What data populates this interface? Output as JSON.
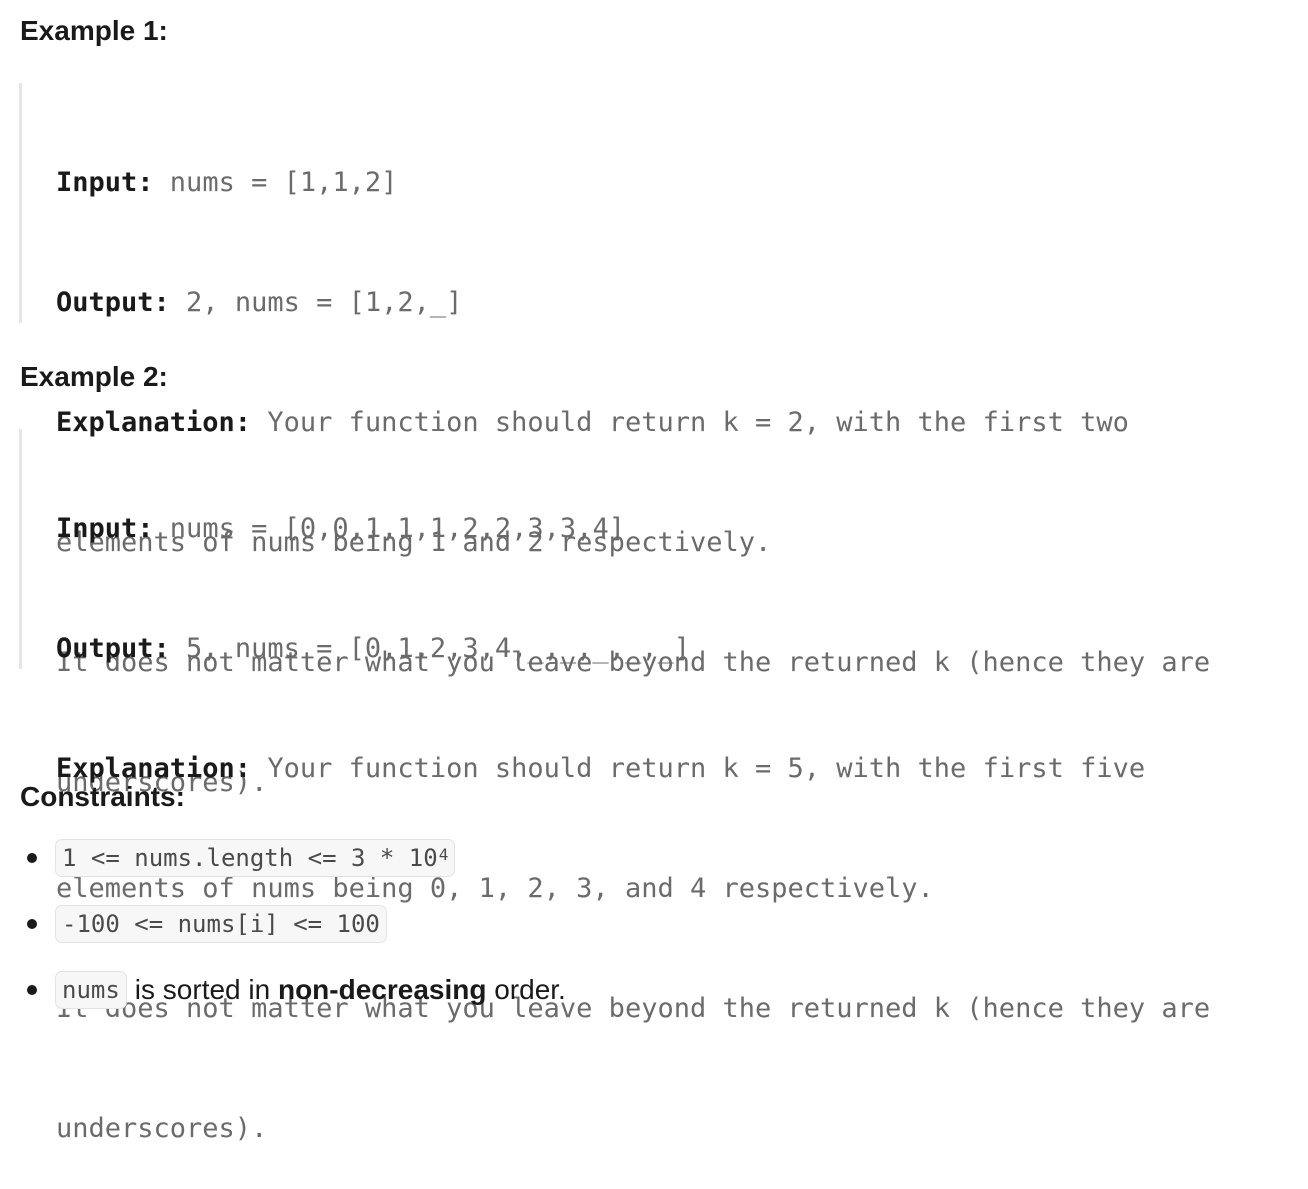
{
  "example1": {
    "heading": "Example 1:",
    "input_label": "Input:",
    "input_value": " nums = [1,1,2]",
    "output_label": "Output:",
    "output_value": " 2, nums = [1,2,_]",
    "explanation_label": "Explanation:",
    "explanation_line1": " Your function should return k = 2, with the first two",
    "explanation_line2": "elements of nums being 1 and 2 respectively.",
    "explanation_line3": "It does not matter what you leave beyond the returned k (hence they are",
    "explanation_line4": "underscores)."
  },
  "example2": {
    "heading": "Example 2:",
    "input_label": "Input:",
    "input_value": " nums = [0,0,1,1,1,2,2,3,3,4]",
    "output_label": "Output:",
    "output_value": " 5, nums = [0,1,2,3,4,_,_,_,_,_]",
    "explanation_label": "Explanation:",
    "explanation_line1": " Your function should return k = 5, with the first five",
    "explanation_line2": "elements of nums being 0, 1, 2, 3, and 4 respectively.",
    "explanation_line3": "It does not matter what you leave beyond the returned k (hence they are",
    "explanation_line4": "underscores)."
  },
  "constraints": {
    "heading": "Constraints:",
    "items": [
      {
        "code": "1 <= nums.length <= 3 * 10",
        "sup": "4"
      },
      {
        "code": "-100 <= nums[i] <= 100"
      },
      {
        "code": "nums",
        "text_before_bold": "is sorted in ",
        "bold": "non-decreasing",
        "text_after_bold": " order."
      }
    ]
  }
}
